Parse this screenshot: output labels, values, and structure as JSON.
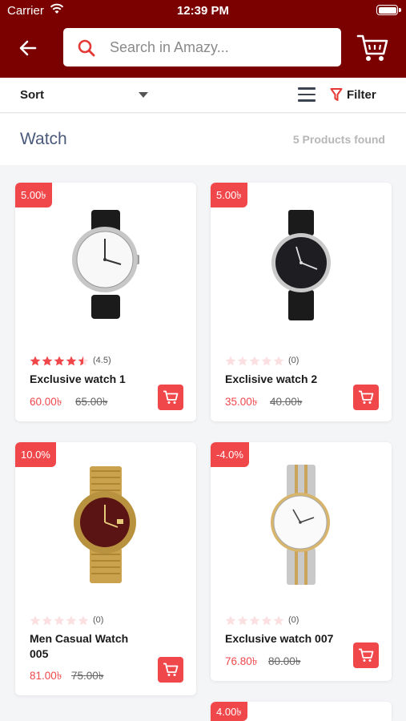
{
  "status": {
    "carrier": "Carrier",
    "time": "12:39 PM"
  },
  "search": {
    "placeholder": "Search in Amazy..."
  },
  "toolbar": {
    "sort_label": "Sort",
    "filter_label": "Filter"
  },
  "category": {
    "title": "Watch",
    "count": "5 Products found"
  },
  "colors": {
    "header": "#7b0000",
    "accent": "#f0474b"
  },
  "products": [
    {
      "badge": "5.00৳",
      "name": "Exclusive watch 1",
      "rating_text": "(4.5)",
      "rating": 4.5,
      "price": "60.00৳",
      "old_price": "65.00৳"
    },
    {
      "badge": "5.00৳",
      "name": "Exclisive watch 2",
      "rating_text": "(0)",
      "rating": 0,
      "price": "35.00৳",
      "old_price": "40.00৳"
    },
    {
      "badge": "10.0%",
      "name": "Men Casual Watch 005",
      "rating_text": "(0)",
      "rating": 0,
      "price": "81.00৳",
      "old_price": "75.00৳"
    },
    {
      "badge": "-4.0%",
      "name": "Exclusive watch 007",
      "rating_text": "(0)",
      "rating": 0,
      "price": "76.80৳",
      "old_price": "80.00৳"
    },
    {
      "badge": "4.00৳"
    }
  ]
}
